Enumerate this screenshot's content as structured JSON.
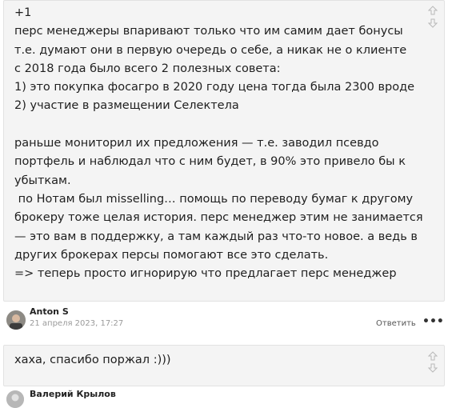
{
  "comments": [
    {
      "text": "+1\nперс менеджеры впаривают только что им самим дает бонусы т.е. думают они в первую очередь о себе, а никак не о клиенте\nс 2018 года было всего 2 полезных совета:\n1) это покупка фосагро в 2020 году цена тогда была 2300 вроде\n2) участие в размещении Селектела\n\nраньше мониторил их предложения — т.е. заводил псевдо портфель и наблюдал что с ним будет, в 90% это привело бы к убыткам.\n по Нотам был misselling… помощь по переводу бумаг к другому брокеру тоже целая история. перс менеджер этим не занимается — это вам в поддержку, а там каждый раз что-то новое. а ведь в других брокерах персы помогают все это сделать.\n=> теперь просто игнорирую что предлагает перс менеджер"
    },
    {
      "author": "Anton S",
      "date": "21 апреля 2023, 17:27",
      "reply_label": "Ответить",
      "more_label": "•••",
      "text": "хаха, спасибо поржал :)))"
    },
    {
      "author": "Валерий Крылов"
    }
  ],
  "icons": {
    "vote_up": "arrow-up-outline-icon",
    "vote_down": "arrow-down-outline-icon"
  },
  "colors": {
    "bubble_bg": "#f4f4f4",
    "text": "#1f1f1f",
    "meta": "#9a9a9a"
  }
}
